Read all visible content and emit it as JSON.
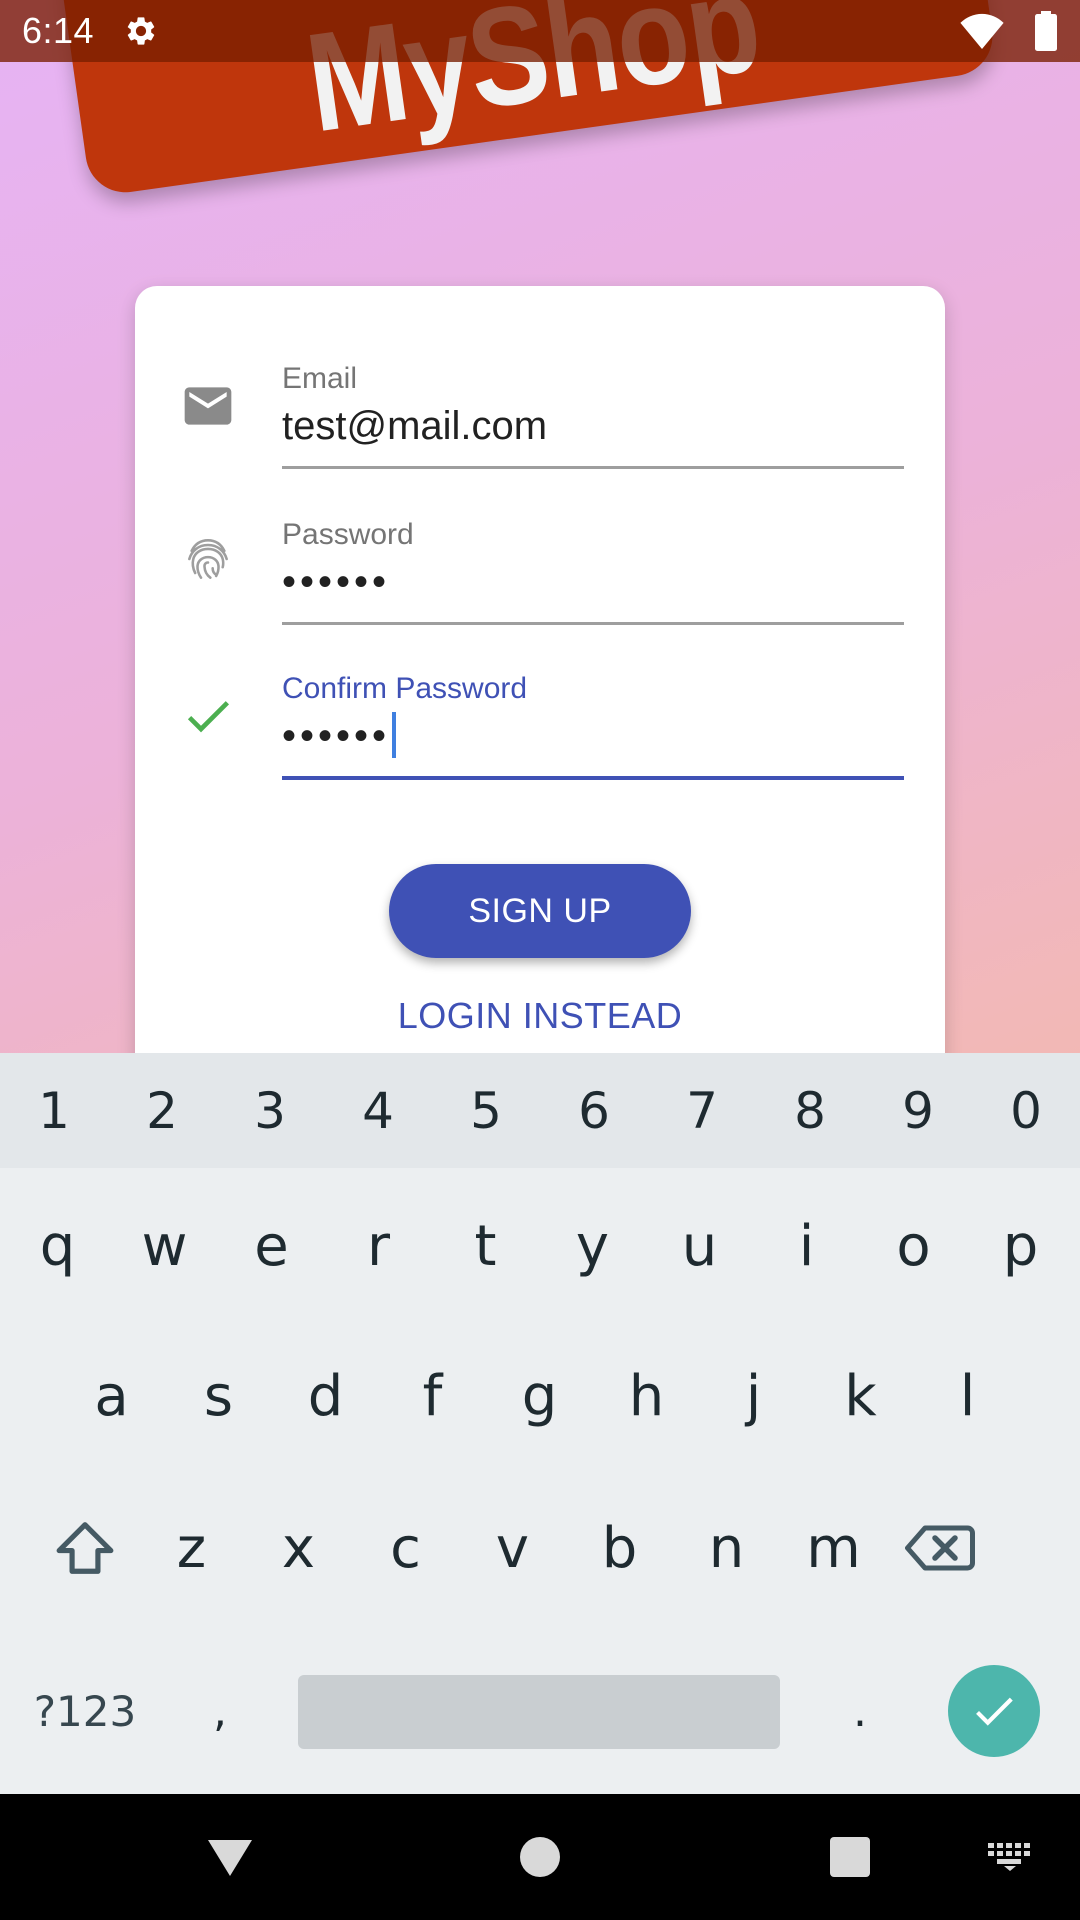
{
  "status_bar": {
    "time": "6:14",
    "icons": [
      "gear-icon",
      "wifi-icon",
      "battery-icon"
    ]
  },
  "app": {
    "logo_text": "MyShop",
    "colors": {
      "banner": "#bf360c",
      "primary": "#3f51b5",
      "success": "#4caf50",
      "enter": "#4db6ac"
    }
  },
  "form": {
    "email": {
      "label": "Email",
      "value": "test@mail.com",
      "icon": "mail-icon"
    },
    "password": {
      "label": "Password",
      "value": "••••••",
      "icon": "fingerprint-icon"
    },
    "confirm_password": {
      "label": "Confirm Password",
      "value": "••••••",
      "icon": "check-icon"
    },
    "signup_label": "SIGN UP",
    "login_label": "LOGIN INSTEAD"
  },
  "keyboard": {
    "numbers": [
      "1",
      "2",
      "3",
      "4",
      "5",
      "6",
      "7",
      "8",
      "9",
      "0"
    ],
    "row1": [
      "q",
      "w",
      "e",
      "r",
      "t",
      "y",
      "u",
      "i",
      "o",
      "p"
    ],
    "row2": [
      "a",
      "s",
      "d",
      "f",
      "g",
      "h",
      "j",
      "k",
      "l"
    ],
    "row3": [
      "z",
      "x",
      "c",
      "v",
      "b",
      "n",
      "m"
    ],
    "symbols_label": "?123",
    "comma": ",",
    "period": "."
  },
  "nav_bar": {
    "icons": [
      "back-icon",
      "home-icon",
      "recents-icon",
      "keyboard-switch-icon"
    ]
  }
}
